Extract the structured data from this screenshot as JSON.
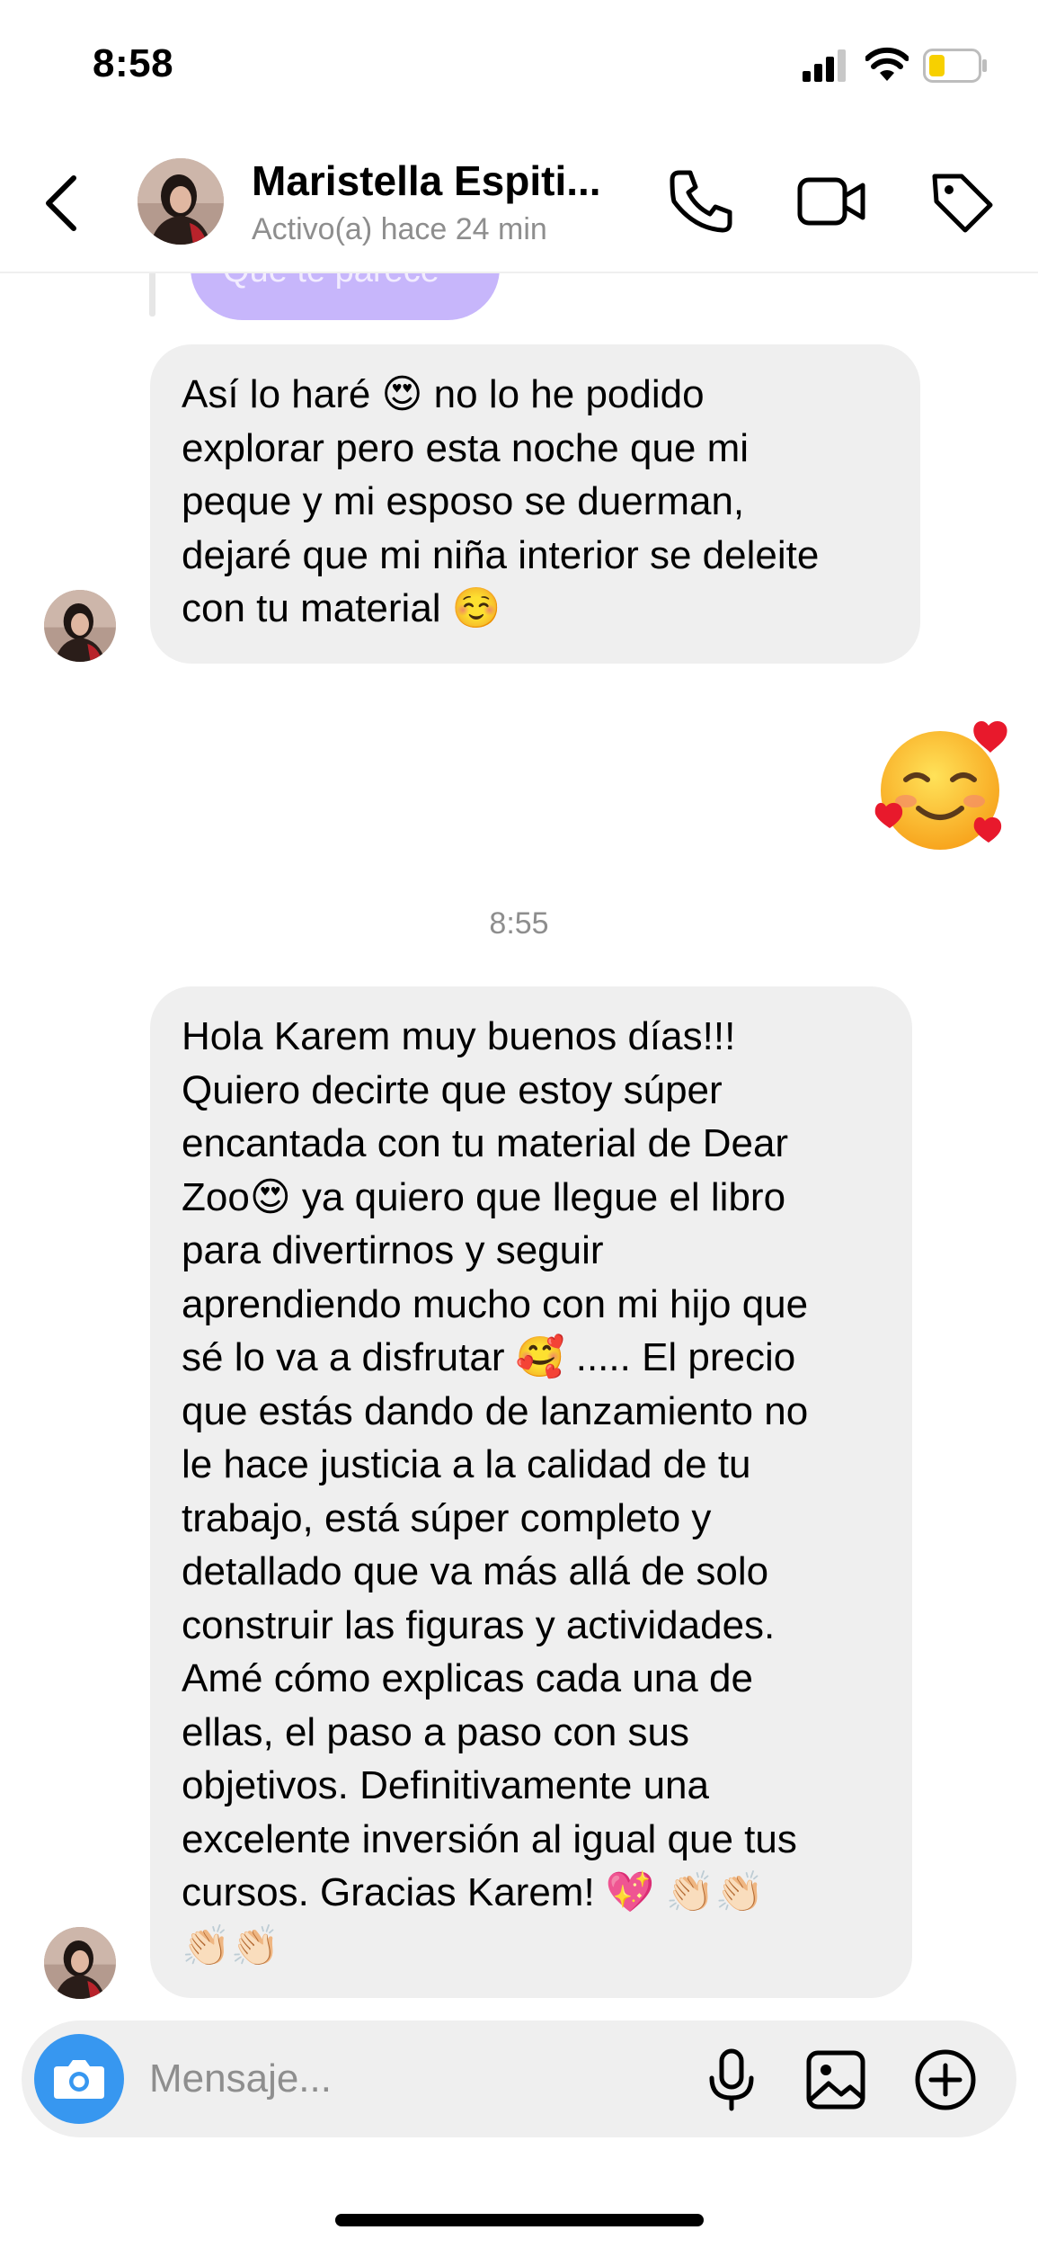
{
  "status_bar": {
    "time": "8:58",
    "battery_color": "#f7d000"
  },
  "header": {
    "contact_name": "Maristella Espiti...",
    "contact_status": "Activo(a) hace 24 min",
    "icons": [
      "back-icon",
      "phone-icon",
      "video-camera-icon",
      "tag-icon"
    ]
  },
  "conversation": {
    "previous_sent_fragment": "Que te parece",
    "messages": [
      {
        "direction": "received",
        "text": "Así lo haré 😍 no lo he podido\nexplorar pero esta noche que mi\npeque y mi esposo se duerman,\ndejaré que mi niña interior se deleite\ncon tu material ☺️"
      },
      {
        "direction": "sent",
        "text": "🥰"
      },
      {
        "direction": "received",
        "text": "Hola Karem muy buenos días!!!\nQuiero decirte que estoy súper\nencantada con tu material de Dear\nZoo😍 ya quiero que llegue el libro\npara divertirnos y seguir\naprendiendo mucho con mi hijo que\nsé lo va a disfrutar 🥰 ..... El precio\nque estás dando de lanzamiento no\nle hace justicia a la calidad de tu\ntrabajo, está súper completo y\ndetallado que va más allá de solo\nconstruir las figuras y actividades.\nAmé cómo explicas cada una de\nellas, el paso a paso con sus\nobjetivos. Definitivamente una\nexcelente inversión al igual que tus\ncursos. Gracias Karem! 💖 👏🏻👏🏻\n👏🏻👏🏻"
      }
    ],
    "timestamp": "8:55",
    "sent_bubble_color": "#c7b6fb",
    "received_bubble_color": "#efefef"
  },
  "composer": {
    "placeholder": "Mensaje...",
    "value": "",
    "accent": "#3797f0",
    "icons": [
      "camera-icon",
      "microphone-icon",
      "image-icon",
      "plus-circle-icon"
    ]
  }
}
